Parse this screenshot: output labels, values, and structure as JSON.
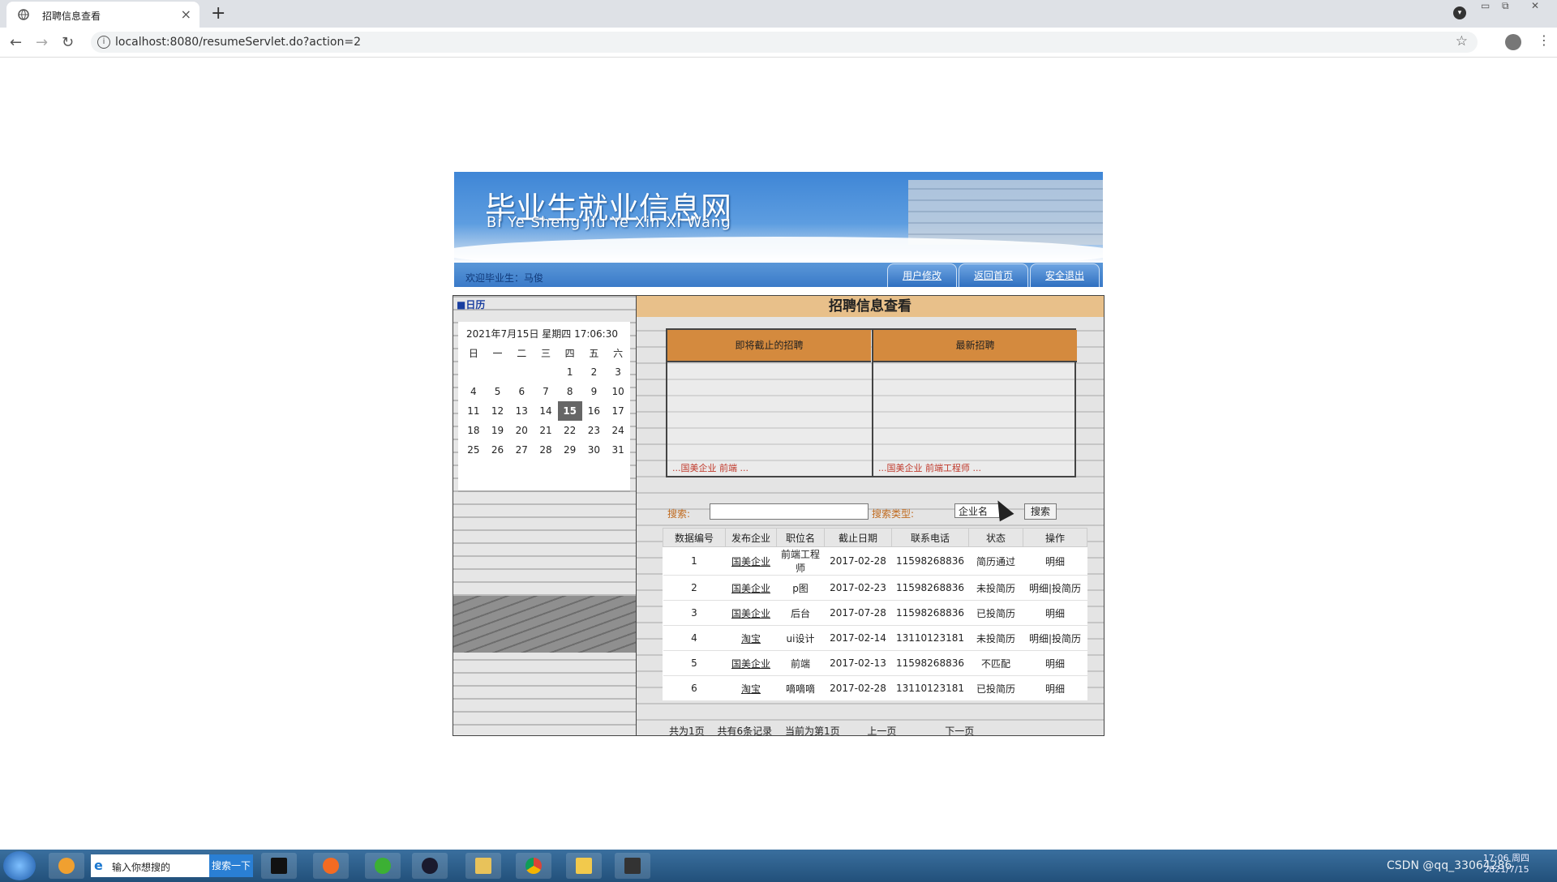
{
  "browser": {
    "tab_title": "招聘信息查看",
    "url": "localhost:8080/resumeServlet.do?action=2"
  },
  "site": {
    "title": "毕业生就业信息网",
    "pinyin": "Bi Ye Sheng Jiu Ye Xin Xi Wang",
    "welcome": "欢迎毕业生：马俊",
    "nav": [
      "用户修改",
      "返回首页",
      "安全退出"
    ]
  },
  "calendar": {
    "heading": "■日历",
    "datetime": "2021年7月15日 星期四  17:06:30",
    "weekdays": [
      "日",
      "一",
      "二",
      "三",
      "四",
      "五",
      "六"
    ],
    "weeks": [
      [
        "",
        "",
        "",
        "",
        "1",
        "2",
        "3"
      ],
      [
        "4",
        "5",
        "6",
        "7",
        "8",
        "9",
        "10"
      ],
      [
        "11",
        "12",
        "13",
        "14",
        "15",
        "16",
        "17"
      ],
      [
        "18",
        "19",
        "20",
        "21",
        "22",
        "23",
        "24"
      ],
      [
        "25",
        "26",
        "27",
        "28",
        "29",
        "30",
        "31"
      ]
    ],
    "today": "15"
  },
  "main": {
    "title": "招聘信息查看",
    "expiring_label": "即将截止的招聘",
    "latest_label": "最新招聘",
    "expiring_ticker": "...国美企业 前端 ...",
    "latest_ticker": "...国美企业 前端工程师 ...",
    "search_label": "搜索:",
    "search_type_label": "搜索类型:",
    "search_type_value": "企业名",
    "search_button": "搜索",
    "columns": [
      "数据编号",
      "发布企业",
      "职位名",
      "截止日期",
      "联系电话",
      "状态",
      "操作"
    ],
    "rows": [
      [
        "1",
        "国美企业",
        "前端工程师",
        "2017-02-28",
        "11598268836",
        "简历通过",
        "明细"
      ],
      [
        "2",
        "国美企业",
        "p图",
        "2017-02-23",
        "11598268836",
        "未投简历",
        "明细|投简历"
      ],
      [
        "3",
        "国美企业",
        "后台",
        "2017-07-28",
        "11598268836",
        "已投简历",
        "明细"
      ],
      [
        "4",
        "淘宝",
        "ui设计",
        "2017-02-14",
        "13110123181",
        "未投简历",
        "明细|投简历"
      ],
      [
        "5",
        "国美企业",
        "前端",
        "2017-02-13",
        "11598268836",
        "不匹配",
        "明细"
      ],
      [
        "6",
        "淘宝",
        "嘀嘀嘀",
        "2017-02-28",
        "13110123181",
        "已投简历",
        "明细"
      ]
    ],
    "pager": [
      "共为1页",
      "共有6条记录",
      "当前为第1页",
      "上一页",
      "下一页"
    ]
  },
  "taskbar": {
    "search_placeholder": "输入你想搜的",
    "search_button": "搜索一下",
    "watermark": "CSDN @qq_33064286",
    "time": "17:06 周四",
    "date": "2021/7/15"
  },
  "colors": {
    "header_bar": "#e8c08a",
    "section_head": "#d48a3e",
    "banner_blue": "#3f86d6",
    "today_bg": "#666666"
  }
}
